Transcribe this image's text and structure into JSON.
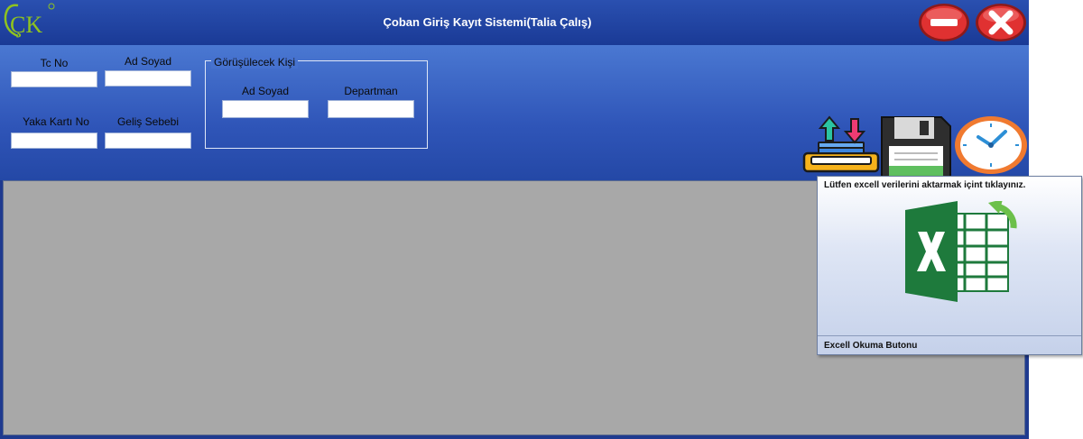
{
  "window": {
    "title": "Çoban  Giriş Kayıt Sistemi(Talia Çalış)",
    "logo_text": "ÇK"
  },
  "form": {
    "tc_no_label": "Tc No",
    "tc_no_value": "",
    "ad_soyad_label": "Ad Soyad",
    "ad_soyad_value": "",
    "yaka_karti_label": "Yaka Kartı No",
    "yaka_karti_value": "",
    "gelis_sebebi_label": "Geliş Sebebi",
    "gelis_sebebi_value": "",
    "group": {
      "title": "Görüşülecek Kişi",
      "ad_soyad_label": "Ad Soyad",
      "ad_soyad_value": "",
      "departman_label": "Departman",
      "departman_value": ""
    }
  },
  "toolbar": {
    "icons": [
      "import-export-icon",
      "save-floppy-icon",
      "clock-icon"
    ]
  },
  "tooltip": {
    "text": "Lütfen excell verilerini aktarmak içint tıklayınız.",
    "footer": "Excell Okuma Butonu",
    "icon": "excel-icon"
  },
  "colors": {
    "titlebar": "#1a3a96",
    "panel": "#3a62c2",
    "grid": "#a8a8a8",
    "excel_green": "#1e7a3c",
    "close_red": "#d8202a"
  }
}
